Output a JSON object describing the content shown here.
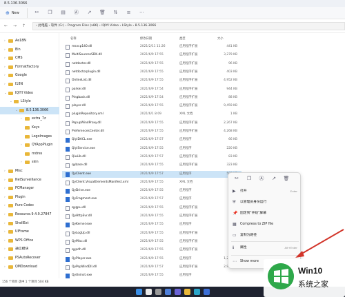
{
  "window": {
    "title": "8.5.136.3066"
  },
  "toolbar": {
    "new_label": "New"
  },
  "address": {
    "path": "› 此电脑 › 软件 (G:) › Program Files (x86) › IQIYI Video › LStyle › 8.5.136.3066"
  },
  "sidebar": {
    "items": [
      {
        "label": "Ae18N"
      },
      {
        "label": "Bin"
      },
      {
        "label": "CMS"
      },
      {
        "label": "FormatFactory"
      },
      {
        "label": "Google"
      },
      {
        "label": "I18N"
      },
      {
        "label": "IQIYI Video"
      },
      {
        "label": "LStyle"
      },
      {
        "label": "8.5.136.3066"
      },
      {
        "label": "extra_7z"
      },
      {
        "label": "Keys"
      },
      {
        "label": "LogoImages"
      },
      {
        "label": "QYAppPlugin"
      },
      {
        "label": "rndres"
      },
      {
        "label": "skin"
      },
      {
        "label": "Misc"
      },
      {
        "label": "NetSurveillance"
      },
      {
        "label": "PCManager"
      },
      {
        "label": "Plugin"
      },
      {
        "label": "Pure Codec"
      },
      {
        "label": "Resource.9.4.9.27847"
      },
      {
        "label": "ShellExt"
      },
      {
        "label": "UIFrame"
      },
      {
        "label": "WPS Office"
      },
      {
        "label": "通信模块"
      },
      {
        "label": "PSAutoRecover"
      },
      {
        "label": "QMDownload"
      }
    ]
  },
  "file_list": {
    "header": {
      "name": "名称",
      "date": "修改日期",
      "type": "类型",
      "size": "大小"
    },
    "rows": [
      {
        "name": "msvcp140.dll",
        "date": "2021/2/11 11:26",
        "type": "应用程序扩展",
        "size": "441 KB"
      },
      {
        "name": "MultiSourcesSDK.dll",
        "date": "2021/6/9 17:55",
        "type": "应用程序扩展",
        "size": "3,279 KB"
      },
      {
        "name": "netdoctor.dll",
        "date": "2021/6/9 17:55",
        "type": "应用程序扩展",
        "size": "96 KB"
      },
      {
        "name": "netdoctorplugin.dll",
        "date": "2021/6/9 17:55",
        "type": "应用程序扩展",
        "size": "403 KB"
      },
      {
        "name": "OnlineList.dll",
        "date": "2021/6/9 17:55",
        "type": "应用程序扩展",
        "size": "4,952 KB"
      },
      {
        "name": "parker.dll",
        "date": "2021/6/9 17:54",
        "type": "应用程序扩展",
        "size": "944 KB"
      },
      {
        "name": "Pingback.dll",
        "date": "2021/6/9 17:54",
        "type": "应用程序扩展",
        "size": "88 KB"
      },
      {
        "name": "player.dll",
        "date": "2021/6/9 17:55",
        "type": "应用程序扩展",
        "size": "9,459 KB"
      },
      {
        "name": "pluginRepository.xml",
        "date": "2021/6/1 8:09",
        "type": "XML 文档",
        "size": "1 KB"
      },
      {
        "name": "PopupWindProxy.dll",
        "date": "2021/6/9 17:55",
        "type": "应用程序扩展",
        "size": "2,267 KB"
      },
      {
        "name": "PreferencesCenter.dll",
        "date": "2021/6/9 17:55",
        "type": "应用程序扩展",
        "size": "4,268 KB"
      },
      {
        "name": "QiyiDACL.exe",
        "date": "2021/6/9 17:57",
        "type": "应用程序",
        "size": "66 KB"
      },
      {
        "name": "QiyiService.exe",
        "date": "2021/6/9 17:55",
        "type": "应用程序",
        "size": "220 KB"
      },
      {
        "name": "QiuLib.dll",
        "date": "2021/6/9 17:57",
        "type": "应用程序扩展",
        "size": "83 KB"
      },
      {
        "name": "qybase.dll",
        "date": "2021/6/9 17:55",
        "type": "应用程序扩展",
        "size": "323 KB"
      },
      {
        "name": "QyClient.exe",
        "date": "2021/6/9 17:57",
        "type": "应用程序",
        "size": "505 KB"
      },
      {
        "name": "QyClient.VisualElementsManifest.xml",
        "date": "2021/6/9 17:55",
        "type": "XML 文档",
        "size": ""
      },
      {
        "name": "QyDrive.exe",
        "date": "2021/6/9 17:55",
        "type": "应用程序",
        "size": ""
      },
      {
        "name": "QyFragment.exe",
        "date": "2021/6/9 17:57",
        "type": "应用程序",
        "size": ""
      },
      {
        "name": "qygpu.dll",
        "date": "2021/6/9 17:55",
        "type": "应用程序扩展",
        "size": ""
      },
      {
        "name": "QyHttpSvr.dll",
        "date": "2021/6/9 17:55",
        "type": "应用程序扩展",
        "size": ""
      },
      {
        "name": "QyKernel.exe",
        "date": "2021/6/9 17:55",
        "type": "应用程序",
        "size": ""
      },
      {
        "name": "QyLogUp.dll",
        "date": "2021/6/9 17:55",
        "type": "应用程序扩展",
        "size": ""
      },
      {
        "name": "QyMisc.dll",
        "date": "2021/6/9 17:55",
        "type": "应用程序扩展",
        "size": ""
      },
      {
        "name": "qypdh.dll",
        "date": "2021/6/9 17:55",
        "type": "应用程序扩展",
        "size": ""
      },
      {
        "name": "QyPlayer.exe",
        "date": "2021/6/9 17:55",
        "type": "应用程序",
        "size": "1,236 KB"
      },
      {
        "name": "QyPopWndDll.dll",
        "date": "2021/6/9 17:57",
        "type": "应用程序扩展",
        "size": "2,946 KB"
      },
      {
        "name": "QyUninst.exe",
        "date": "2021/6/9 17:55",
        "type": "应用程序",
        "size": ""
      }
    ]
  },
  "status": {
    "text": "156 个项目   选中 1 个项目  504 KB"
  },
  "context_menu": {
    "items": [
      {
        "label": "打开",
        "shortcut": "Enter"
      },
      {
        "label": "以管理员身份运行",
        "shortcut": ""
      },
      {
        "label": "固定到\"开始\"屏幕",
        "shortcut": ""
      },
      {
        "label": "Compress to ZIP file",
        "shortcut": ""
      },
      {
        "label": "复制为路径",
        "shortcut": ""
      },
      {
        "label": "属性",
        "shortcut": "Alt+Enter"
      },
      {
        "label": "Show more",
        "shortcut": ""
      }
    ]
  },
  "watermark": {
    "title": "Win10",
    "subtitle": "系统之家"
  },
  "colors": {
    "selection": "#cce4f7",
    "folder": "#e9b739",
    "accent": "#2f6fd0",
    "arrow": "#d2352a",
    "logo_green": "#2ea84a"
  }
}
